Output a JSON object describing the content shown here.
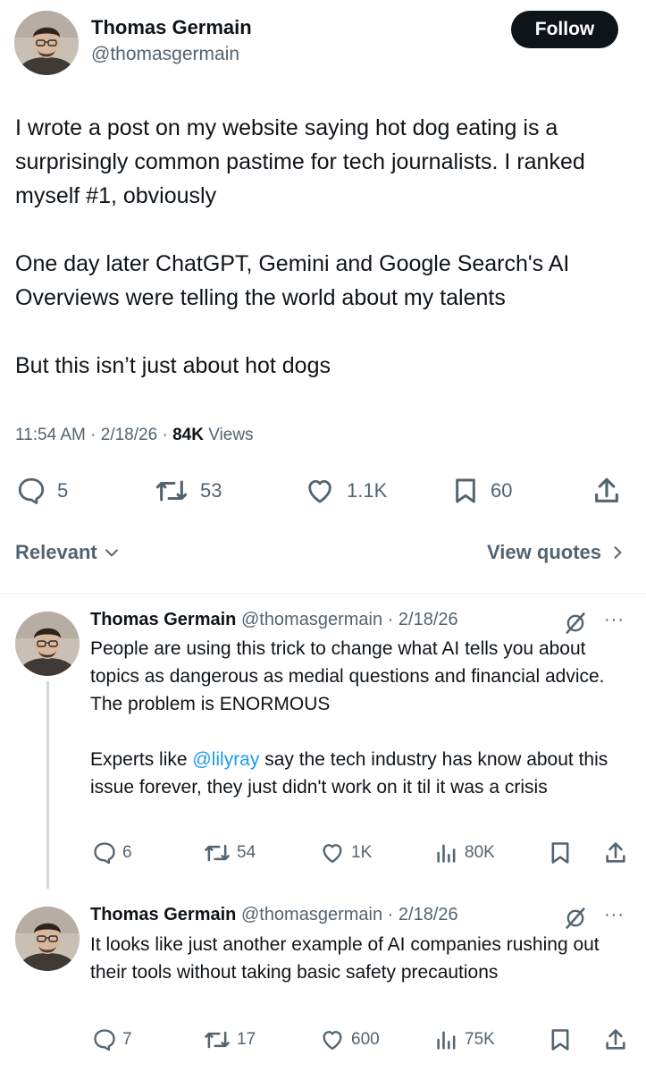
{
  "tweet": {
    "author_name": "Thomas Germain",
    "author_handle": "@thomasgermain",
    "follow_label": "Follow",
    "text": "I wrote a post on my website saying hot dog eating is a surprisingly common pastime for tech journalists. I ranked myself #1, obviously\n\nOne day later ChatGPT, Gemini and Google Search's AI Overviews were telling the world about my talents\n\nBut this isn’t just about hot dogs",
    "time": "11:54 AM",
    "date": "2/18/26",
    "views_count": "84K",
    "views_label": "Views",
    "stats": {
      "replies": "5",
      "reposts": "53",
      "likes": "1.1K",
      "bookmarks": "60"
    }
  },
  "sort": {
    "label": "Relevant",
    "view_quotes": "View quotes"
  },
  "replies": [
    {
      "author_name": "Thomas Germain",
      "author_handle": "@thomasgermain",
      "date": "· 2/18/26",
      "text_part1": "People are using this trick to change what AI tells you about topics as dangerous as medial questions and financial advice. The problem is ENORMOUS\n\nExperts like ",
      "mention": "@lilyray",
      "text_part2": " say the tech industry has know about this issue forever, they just didn't work on it til it was a crisis",
      "stats": {
        "replies": "6",
        "reposts": "54",
        "likes": "1K",
        "views": "80K"
      }
    },
    {
      "author_name": "Thomas Germain",
      "author_handle": "@thomasgermain",
      "date": "· 2/18/26",
      "text": "It looks like just another example of AI companies rushing out their tools without taking basic safety precautions",
      "stats": {
        "replies": "7",
        "reposts": "17",
        "likes": "600",
        "views": "75K"
      }
    }
  ],
  "icons": {
    "reply": "reply-icon",
    "repost": "repost-icon",
    "like": "heart-icon",
    "bookmark": "bookmark-icon",
    "share": "share-icon",
    "views": "views-icon",
    "grok": "grok-icon",
    "more": "more-icon"
  },
  "colors": {
    "text": "#0f1419",
    "secondary": "#536471",
    "link": "#1d9bf0",
    "follow_bg": "#0f1419"
  }
}
